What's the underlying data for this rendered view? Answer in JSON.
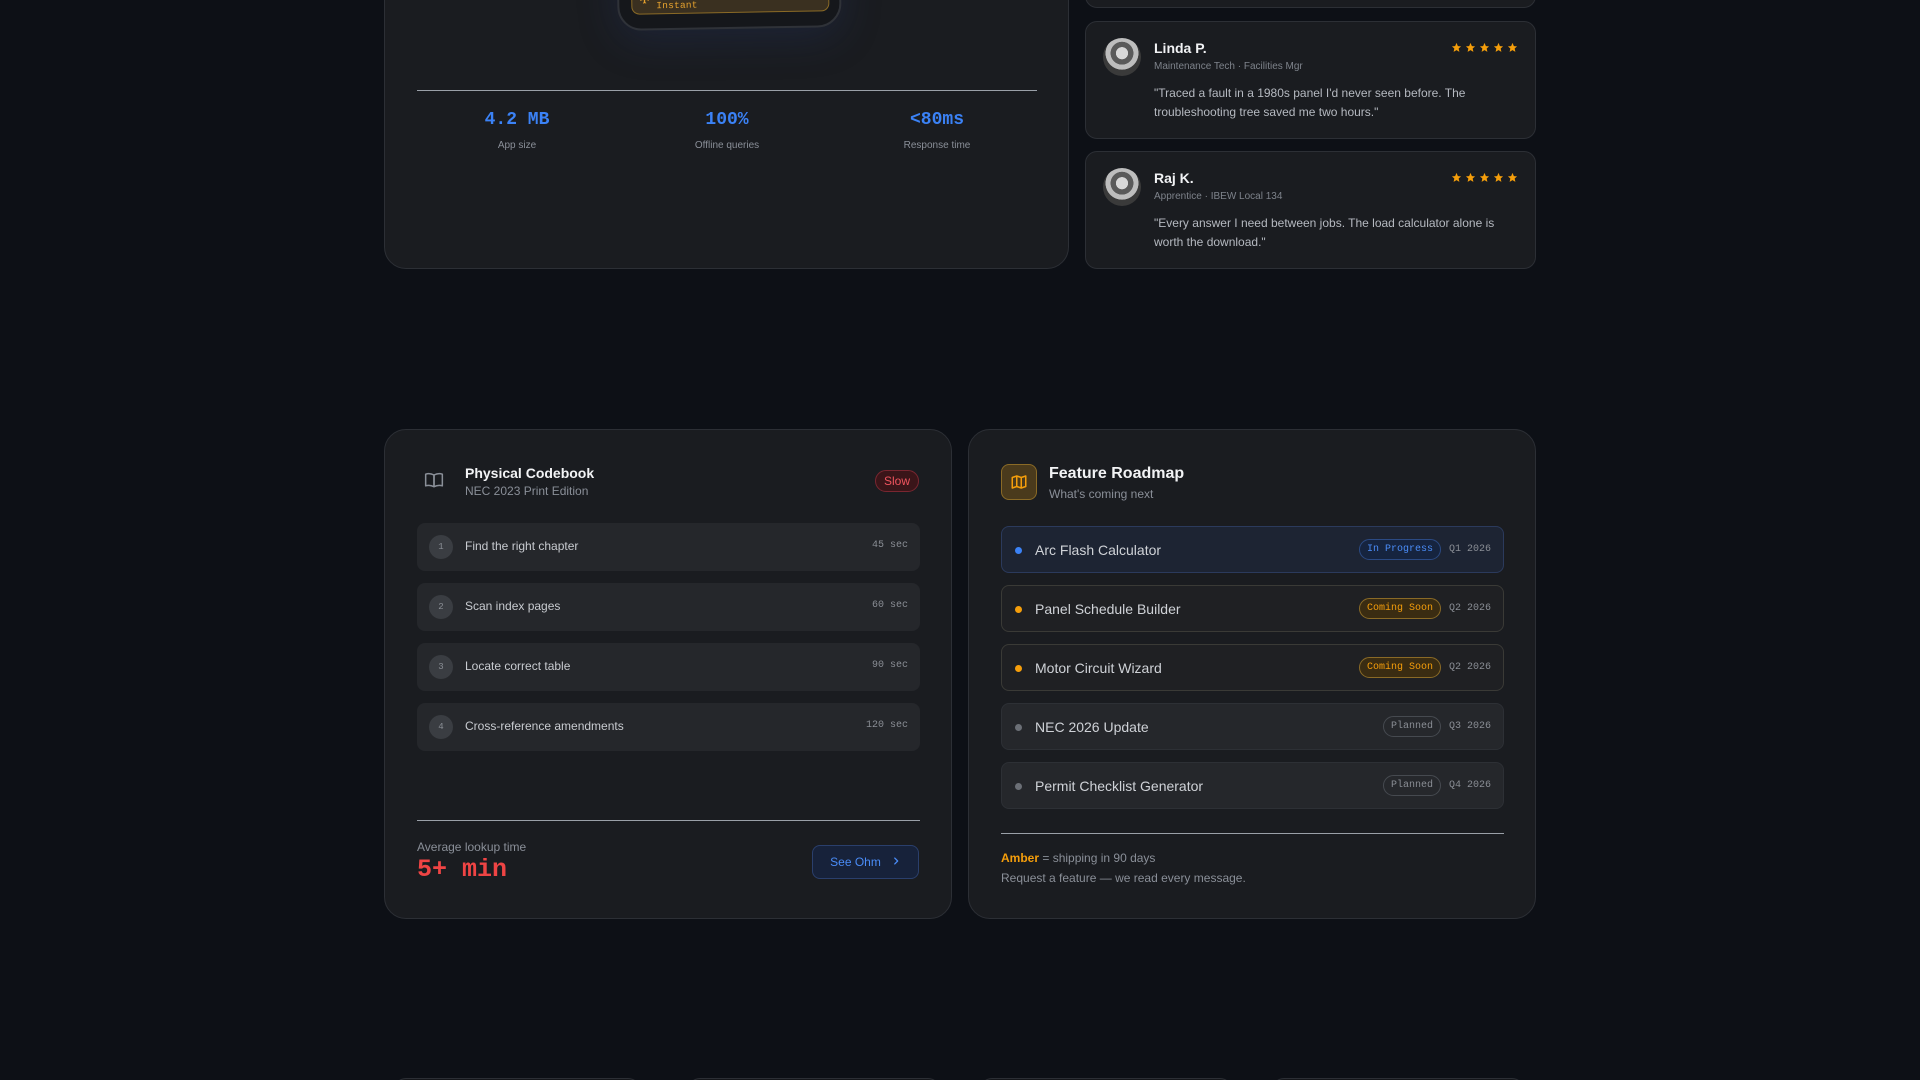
{
  "stats_card": {
    "airplane_pill": "Airplane Mode · Results Instant",
    "stats": [
      {
        "value": "4.2 MB",
        "label": "App size"
      },
      {
        "value": "100%",
        "label": "Offline queries"
      },
      {
        "value": "<80ms",
        "label": "Response time"
      }
    ]
  },
  "testimonials": [
    {
      "name": "Linda P.",
      "role": "Maintenance Tech · Facilities Mgr",
      "rating": 5,
      "quote": "\"Traced a fault in a 1980s panel I'd never seen before. The troubleshooting tree saved me two hours.\""
    },
    {
      "name": "Raj K.",
      "role": "Apprentice · IBEW Local 134",
      "rating": 5,
      "quote": "\"Every answer I need between jobs. The load calculator alone is worth the download.\""
    }
  ],
  "codebook": {
    "title": "Physical Codebook",
    "subtitle": "NEC 2023 Print Edition",
    "badge": "Slow",
    "steps": [
      {
        "num": "1",
        "label": "Find the right chapter",
        "time": "45 sec"
      },
      {
        "num": "2",
        "label": "Scan index pages",
        "time": "60 sec"
      },
      {
        "num": "3",
        "label": "Locate correct table",
        "time": "90 sec"
      },
      {
        "num": "4",
        "label": "Cross-reference amendments",
        "time": "120 sec"
      }
    ],
    "avg_label": "Average lookup time",
    "avg_value": "5+ min",
    "cta_label": "See Ohm"
  },
  "roadmap": {
    "title": "Feature Roadmap",
    "subtitle": "What's coming next",
    "items": [
      {
        "label": "Arc Flash Calculator",
        "status": "In Progress",
        "quarter": "Q1 2026"
      },
      {
        "label": "Panel Schedule Builder",
        "status": "Coming Soon",
        "quarter": "Q2 2026"
      },
      {
        "label": "Motor Circuit Wizard",
        "status": "Coming Soon",
        "quarter": "Q2 2026"
      },
      {
        "label": "NEC 2026 Update",
        "status": "Planned",
        "quarter": "Q3 2026"
      },
      {
        "label": "Permit Checklist Generator",
        "status": "Planned",
        "quarter": "Q4 2026"
      }
    ],
    "legend_key": "Amber",
    "legend_text": " = shipping in 90 days",
    "request_text": "Request a feature — we read every message."
  },
  "colors": {
    "accent_blue": "#3b82f6",
    "amber": "#f59e0b",
    "danger": "#ef4444",
    "star": "#f59e0b",
    "background": "#0d1016"
  },
  "icons": [
    "airplane-icon",
    "book-icon",
    "map-icon",
    "chevron-right-icon",
    "star-icon"
  ]
}
